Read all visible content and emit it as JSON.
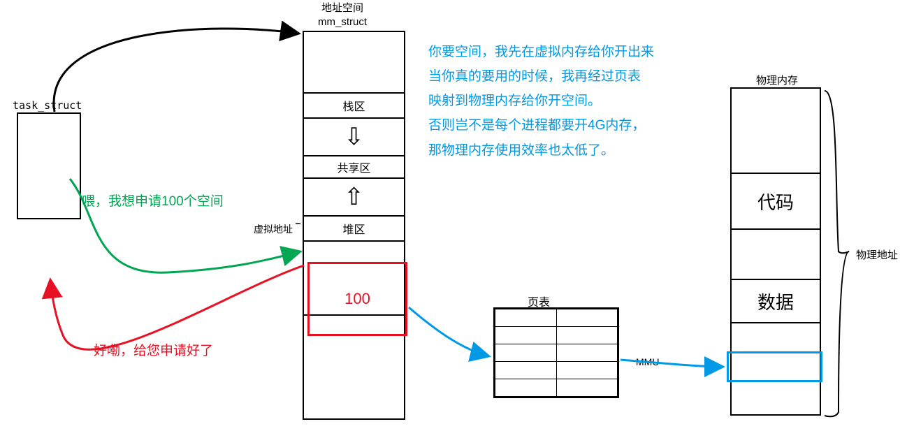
{
  "labels": {
    "task_struct": "task_struct",
    "mm_title_line1": "地址空间",
    "mm_title_line2": "mm_struct",
    "virtual_address": "虚拟地址",
    "page_table": "页表",
    "mmu": "MMU",
    "physical_memory": "物理内存",
    "physical_address": "物理地址"
  },
  "mm_struct_regions": {
    "stack": "栈区",
    "shared": "共享区",
    "heap": "堆区"
  },
  "alloc_value": "100",
  "phys_mem_regions": {
    "code": "代码",
    "data": "数据"
  },
  "annotations": {
    "blue_line1": "你要空间，我先在虚拟内存给你开出来",
    "blue_line2": "当你真的要用的时候，我再经过页表",
    "blue_line3": "映射到物理内存给你开空间。",
    "blue_line4": "否则岂不是每个进程都要开4G内存，",
    "blue_line5": "那物理内存使用效率也太低了。",
    "green": "喂，我想申请100个空间",
    "red": "好嘞，给您申请好了"
  },
  "icons": {
    "down_arrow": "⇩",
    "up_arrow": "⇧"
  }
}
